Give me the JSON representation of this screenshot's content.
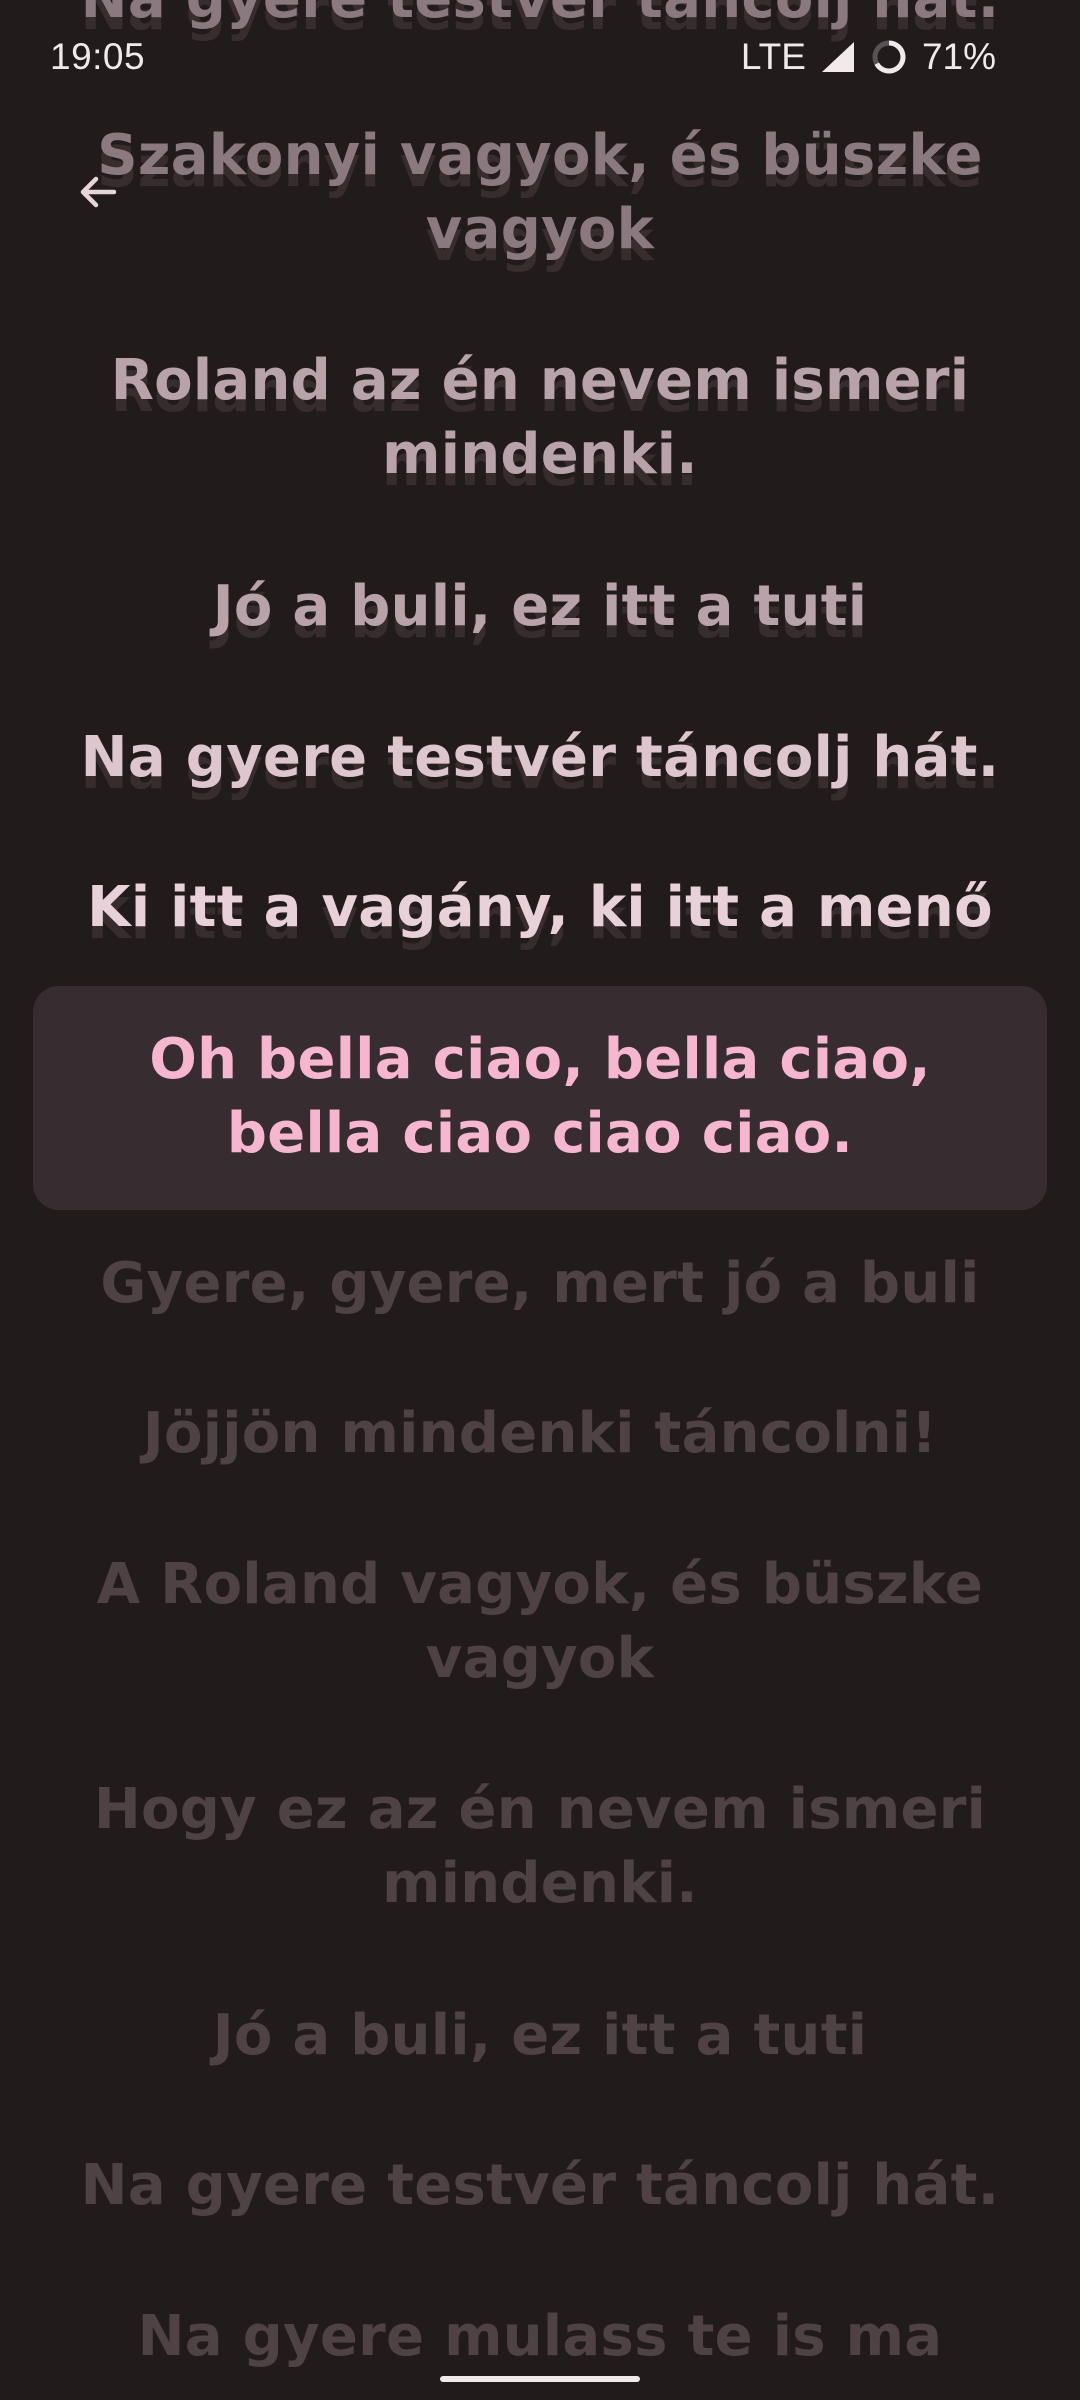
{
  "status_bar": {
    "time": "19:05",
    "network": "LTE",
    "battery": "71%"
  },
  "icons": {
    "back": "arrow-back-icon",
    "signal": "signal-icon",
    "battery": "battery-ring-icon"
  },
  "colors": {
    "background": "#211b1c",
    "active_text": "#f6b6cf",
    "active_box": "#372d31"
  },
  "lyrics": [
    {
      "text": "Na gyere testvér táncolj hát."
    },
    {
      "text": "Szakonyi vagyok, és büszke vagyok"
    },
    {
      "text": "Roland az én nevem ismeri mindenki."
    },
    {
      "text": "Jó a buli, ez itt a tuti"
    },
    {
      "text": "Na gyere testvér táncolj hát."
    },
    {
      "text": "Ki itt a vagány, ki itt a menő"
    },
    {
      "text": "Oh bella ciao, bella ciao, bella ciao ciao ciao."
    },
    {
      "text": "Gyere, gyere, mert jó a buli"
    },
    {
      "text": "Jöjjön mindenki táncolni!"
    },
    {
      "text": "A Roland vagyok, és büszke vagyok"
    },
    {
      "text": "Hogy ez az én nevem ismeri mindenki."
    },
    {
      "text": "Jó a buli, ez itt a tuti"
    },
    {
      "text": "Na gyere testvér táncolj hát."
    },
    {
      "text": "Na gyere mulass te is ma"
    }
  ],
  "active_index": 6
}
